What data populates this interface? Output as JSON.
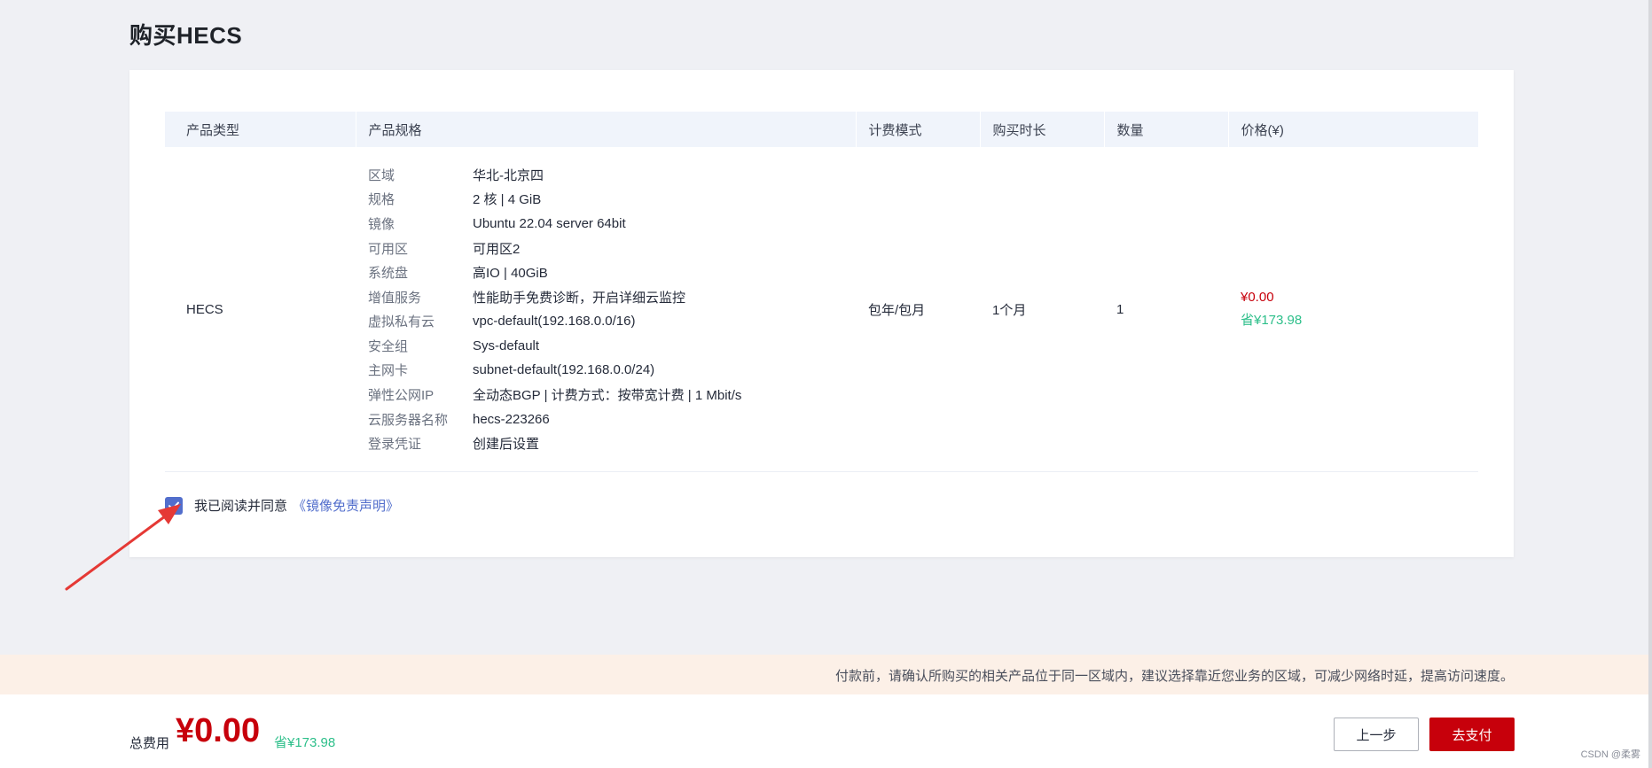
{
  "page": {
    "title": "购买HECS"
  },
  "table": {
    "headers": {
      "type": "产品类型",
      "spec": "产品规格",
      "billing": "计费模式",
      "duration": "购买时长",
      "quantity": "数量",
      "price": "价格(¥)"
    },
    "row": {
      "type": "HECS",
      "specs": [
        {
          "key": "区域",
          "value": "华北-北京四"
        },
        {
          "key": "规格",
          "value": "2 核 | 4 GiB"
        },
        {
          "key": "镜像",
          "value": "Ubuntu 22.04 server 64bit"
        },
        {
          "key": "可用区",
          "value": "可用区2"
        },
        {
          "key": "系统盘",
          "value": "高IO | 40GiB"
        },
        {
          "key": "增值服务",
          "value": "性能助手免费诊断，开启详细云监控"
        },
        {
          "key": "虚拟私有云",
          "value": "vpc-default(192.168.0.0/16)"
        },
        {
          "key": "安全组",
          "value": "Sys-default"
        },
        {
          "key": "主网卡",
          "value": "subnet-default(192.168.0.0/24)"
        },
        {
          "key": "弹性公网IP",
          "value": "全动态BGP | 计费方式：按带宽计费 | 1 Mbit/s"
        },
        {
          "key": "云服务器名称",
          "value": "hecs-223266"
        },
        {
          "key": "登录凭证",
          "value": "创建后设置"
        }
      ],
      "billing": "包年/包月",
      "duration": "1个月",
      "quantity": "1",
      "price": "¥0.00",
      "saving": "省¥173.98"
    }
  },
  "agreement": {
    "checked": true,
    "label": "我已阅读并同意",
    "link": "《镜像免责声明》"
  },
  "notice": {
    "text": "付款前，请确认所购买的相关产品位于同一区域内，建议选择靠近您业务的区域，可减少网络时延，提高访问速度。"
  },
  "footer": {
    "total_label": "总费用",
    "total_amount": "¥0.00",
    "total_saving": "省¥173.98",
    "prev_button": "上一步",
    "pay_button": "去支付"
  },
  "watermark": "CSDN @柔雾",
  "colors": {
    "accent": "#c7000b",
    "link": "#526ecc",
    "saving": "#2dbf8a",
    "annotation_arrow": "#e53935"
  },
  "icons": {
    "checkbox": "check-icon"
  }
}
